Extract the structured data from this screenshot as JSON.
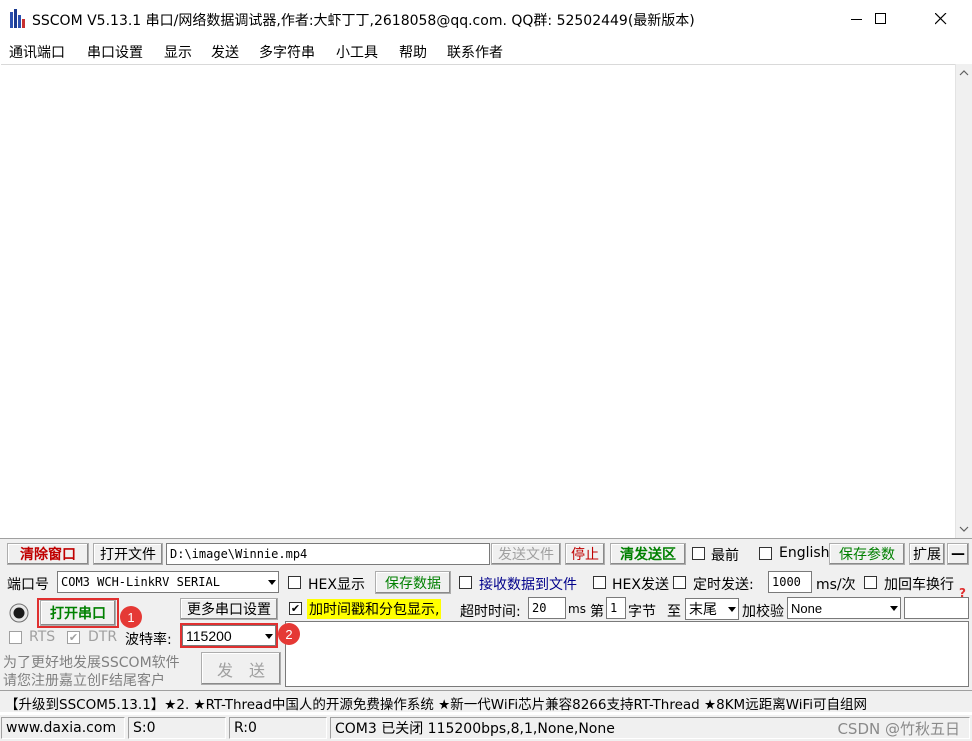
{
  "window": {
    "title": "SSCOM V5.13.1 串口/网络数据调试器,作者:大虾丁丁,2618058@qq.com. QQ群:  52502449(最新版本)",
    "minimize_icon": "minimize-icon",
    "maximize_icon": "maximize-icon",
    "close_icon": "close-icon"
  },
  "menu": [
    "通讯端口",
    "串口设置",
    "显示",
    "发送",
    "多字符串",
    "小工具",
    "帮助",
    "联系作者"
  ],
  "toolbar": {
    "clear_window": "清除窗口",
    "open_file": "打开文件",
    "file_path": "D:\\image\\Winnie.mp4",
    "send_file": "发送文件",
    "stop": "停止",
    "clear_send_area": "清发送区",
    "top_most": "最前",
    "english": "English",
    "save_params": "保存参数",
    "expand": "扩展",
    "collapse": "—"
  },
  "port": {
    "port_label": "端口号",
    "port_value": "COM3 WCH-LinkRV SERIAL",
    "open_port": "打开串口",
    "more_settings": "更多串口设置",
    "rts": "RTS",
    "dtr": "DTR",
    "baud_label": "波特率:",
    "baud_value": "115200",
    "promo_line1": "为了更好地发展SSCOM软件",
    "promo_line2": "请您注册嘉立创F结尾客户",
    "send": "发　送"
  },
  "receive_options": {
    "hex_display": "HEX显示",
    "save_data": "保存数据",
    "receive_to_file": "接收数据到文件",
    "timestamp": "加时间戳和分包显示,",
    "timeout_label": "超时时间:",
    "timeout_value": "20",
    "timeout_unit": "ms"
  },
  "send_options": {
    "hex_send": "HEX发送",
    "timed_send": "定时发送:",
    "interval_value": "1000",
    "interval_unit": "ms/次",
    "add_crlf": "加回车换行",
    "byte_prefix": "第",
    "byte_value": "1",
    "byte_label": "字节",
    "to_label": "至",
    "end_value": "末尾",
    "checksum_label": "加校验",
    "checksum_value": "None"
  },
  "annotations": [
    "1",
    "2"
  ],
  "ticker_text": "【升级到SSCOM5.13.1】★2. ★RT-Thread中国人的开源免费操作系统 ★新一代WiFi芯片兼容8266支持RT-Thread ★8KM远距离WiFi可自组网",
  "status": {
    "website": "www.daxia.com",
    "sent": "S:0",
    "received": "R:0",
    "port_status": "COM3 已关闭  115200bps,8,1,None,None",
    "watermark": "CSDN @竹秋五日"
  },
  "colors": {
    "accent_green": "#008000",
    "accent_red": "#c00000",
    "highlight_yellow": "#ffff00",
    "annotation_red": "#e53935"
  }
}
